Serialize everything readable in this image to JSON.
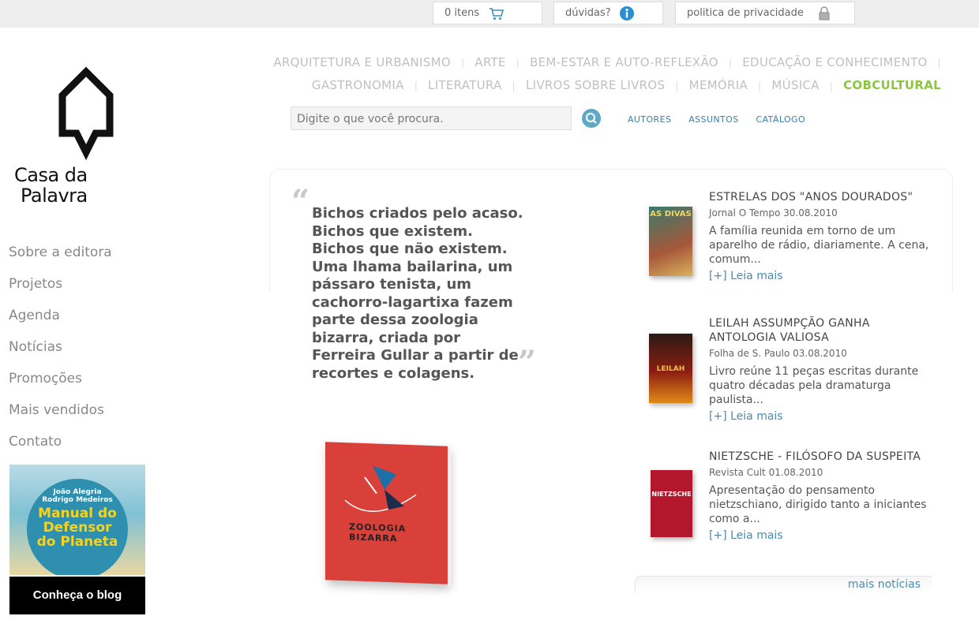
{
  "topbar": {
    "cart_label": "0 itens",
    "help_label": "dúvidas?",
    "privacy_label": "politica de privacidade"
  },
  "logo": {
    "line1": "Casa da",
    "line2": "Palavra"
  },
  "left_nav": [
    "Sobre a editora",
    "Projetos",
    "Agenda",
    "Notícias",
    "Promoções",
    "Mais vendidos",
    "Contato"
  ],
  "promo": {
    "authors": "João Alegria\nRodrigo Medeiros",
    "book_title_1": "Manual do",
    "book_title_2": "Defensor",
    "book_title_3": "do Planeta",
    "button": "Conheça o blog"
  },
  "categories": {
    "row1": [
      "ARQUITETURA E URBANISMO",
      "ARTE",
      "BEM-ESTAR E AUTO-REFLEXÃO",
      "EDUCAÇÃO E CONHECIMENTO"
    ],
    "row2": [
      "GASTRONOMIA",
      "LITERATURA",
      "LIVROS SOBRE LIVROS",
      "MEMÓRIA",
      "MÚSICA",
      "COBCULTURAL"
    ],
    "active": "COBCULTURAL",
    "active_color": "#8cc63f"
  },
  "search": {
    "placeholder": "Digite o que você procura."
  },
  "sublinks": [
    "AUTORES",
    "ASSUNTOS",
    "CATÁLOGO"
  ],
  "featured": {
    "quote": "Bichos criados pelo acaso. Bichos que existem. Bichos que não existem. Uma lhama bailarina, um pássaro tenista, um cachorro-lagartixa fazem parte dessa zoologia bizarra, criada por Ferreira Gullar a partir de recortes e colagens.",
    "book_cover_text": "ZOOLOGIA BIZARRA"
  },
  "news": [
    {
      "title": "ESTRELAS DOS \"ANOS DOURADOS\"",
      "source": "Jornal O Tempo 30.08.2010",
      "excerpt": "A família reunida em torno de um aparelho de rádio, diariamente. A cena, comum...",
      "more": "[+] Leia mais",
      "thumb_text": "AS DIVAS"
    },
    {
      "title": "LEILAH ASSUMPÇÃO GANHA ANTOLOGIA VALIOSA",
      "source": "Folha de S. Paulo 03.08.2010",
      "excerpt": "Livro reúne 11 peças escritas durante quatro décadas pela dramaturga paulista...",
      "more": "[+] Leia mais",
      "thumb_text": "LEILAH"
    },
    {
      "title": "NIETZSCHE - FILÓSOFO DA SUSPEITA",
      "source": "Revista Cult 01.08.2010",
      "excerpt": "Apresentação do pensamento nietzschiano, dirigido tanto a iniciantes como a...",
      "more": "[+] Leia mais",
      "thumb_text": "NIETZSCHE"
    }
  ],
  "more_news": "mais notícias"
}
